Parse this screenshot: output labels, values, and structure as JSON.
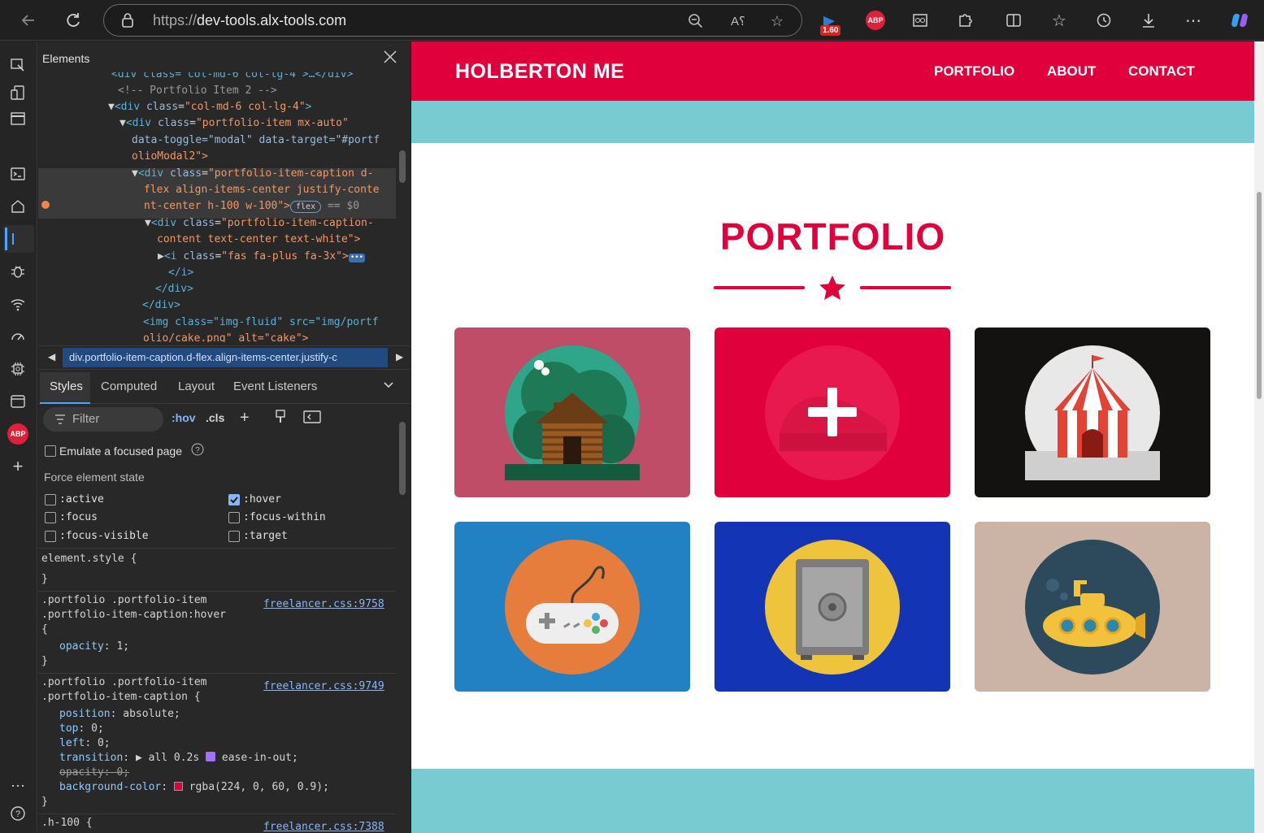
{
  "browser": {
    "url_protocol": "https://",
    "url_host": "dev-tools.alx-tools.com",
    "extension_badge": "1.60",
    "abp_label": "ABP"
  },
  "devtools": {
    "panel_title": "Elements",
    "dom": {
      "line0": "<div class=\"col-md-6 col-lg-4\">…</div>",
      "comment": "<!-- Portfolio Item 2 -->",
      "l2_tag": "<div ",
      "l2_attr": "class",
      "l2_val": "\"col-md-6 col-lg-4\"",
      "l3_attr": "class",
      "l3_val": "\"portfolio-item mx-auto\"",
      "l4": "data-toggle=\"modal\" data-target=\"#portf",
      "l5": "olioModal2\">",
      "l6_val": "\"portfolio-item-caption d-",
      "l7": "flex align-items-center justify-conte",
      "l8": "nt-center h-100 w-100\">",
      "flex_badge": "flex",
      "eq_sel": "== $0",
      "l9_val": "\"portfolio-item-caption-",
      "l10": "content text-center text-white\">",
      "l11_val": "\"fas fa-plus fa-3x\">",
      "l12": "</i>",
      "l13": "</div>",
      "l14": "</div>",
      "l15": "<img class=\"img-fluid\" src=\"img/portf",
      "l16": "olio/cake.png\" alt=\"cake\">"
    },
    "breadcrumb": "div.portfolio-item-caption.d-flex.align-items-center.justify-c",
    "tabs": [
      "Styles",
      "Computed",
      "Layout",
      "Event Listeners"
    ],
    "filter_placeholder": "Filter",
    "hov": ":hov",
    "cls": ".cls",
    "emulate_focus": "Emulate a focused page",
    "force_state_title": "Force element state",
    "states": [
      ":active",
      ":hover",
      ":focus",
      ":focus-within",
      ":focus-visible",
      ":target"
    ],
    "rules": {
      "element_style": "element.style {",
      "close_brace": "}",
      "r1_sel1": ".portfolio .portfolio-item",
      "r1_sel2": ".portfolio-item-caption:hover",
      "r1_open": "{",
      "r1_link": "freelancer.css:9758",
      "r1_prop": "opacity",
      "r1_value": "1;",
      "r2_sel1": ".portfolio .portfolio-item",
      "r2_sel2": ".portfolio-item-caption {",
      "r2_link": "freelancer.css:9749",
      "r2_p1": "position",
      "r2_v1": "absolute;",
      "r2_p2": "top",
      "r2_v2": "0;",
      "r2_p3": "left",
      "r2_v3": "0;",
      "r2_p4": "transition",
      "r2_v4a": "all 0.2s",
      "r2_v4b": "ease-in-out;",
      "r2_p5_struck": "opacity: 0;",
      "r2_p6": "background-color",
      "r2_v6": "rgba(224, 0, 60, 0.9);",
      "r3_sel": ".h-100 {",
      "r3_link": "freelancer.css:7388"
    }
  },
  "webpage": {
    "brand": "HOLBERTON ME",
    "nav": [
      "PORTFOLIO",
      "ABOUT",
      "CONTACT"
    ],
    "section_title": "PORTFOLIO",
    "accent_color": "#e0003c",
    "teal_color": "#78cbd1",
    "portfolio_items": [
      {
        "name": "cabin",
        "bg": "#c04d68",
        "circle": "#2fa589"
      },
      {
        "name": "cake",
        "bg": "#e0003c",
        "circle": "#e8194e",
        "hovered": true
      },
      {
        "name": "circus",
        "bg": "#141210",
        "circle": "#e8e8e8"
      },
      {
        "name": "game",
        "bg": "#2181c2",
        "circle": "#e67d3c"
      },
      {
        "name": "safe",
        "bg": "#1434b6",
        "circle": "#eec43c"
      },
      {
        "name": "submarine",
        "bg": "#cbb4a6",
        "circle": "#2c4a5c"
      }
    ]
  }
}
